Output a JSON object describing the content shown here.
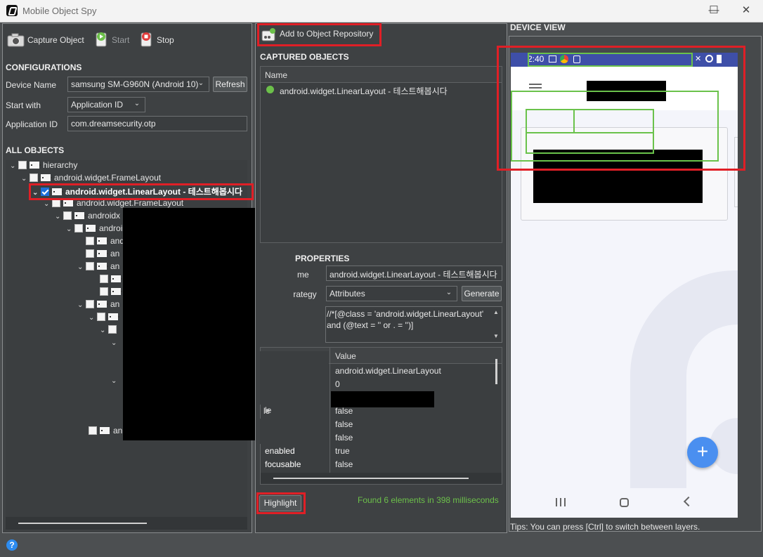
{
  "window": {
    "title": "Mobile Object Spy",
    "minimize": "—",
    "maximize": "☐",
    "close": "✕"
  },
  "toolbar": {
    "capture": "Capture Object",
    "start": "Start",
    "stop": "Stop"
  },
  "config": {
    "heading": "CONFIGURATIONS",
    "device_label": "Device Name",
    "device_value": "samsung SM-G960N (Android 10)",
    "refresh": "Refresh",
    "start_with_label": "Start with",
    "start_with_value": "Application ID",
    "app_id_label": "Application ID",
    "app_id_value": "com.dreamsecurity.otp"
  },
  "all_objects": {
    "heading": "ALL OBJECTS",
    "rows": [
      {
        "label": "hierarchy"
      },
      {
        "label": "android.widget.FrameLayout"
      },
      {
        "label": "android.widget.LinearLayout - 테스트해봅시다"
      },
      {
        "label": "android.widget.FrameLayout"
      },
      {
        "label": "androidx"
      },
      {
        "label": "androi"
      },
      {
        "label": "andr"
      },
      {
        "label": "an"
      },
      {
        "label": "an"
      },
      {
        "label": "an"
      },
      {
        "label": "an"
      }
    ]
  },
  "repo": {
    "add_button": "Add to Object Repository"
  },
  "captured": {
    "heading": "CAPTURED OBJECTS",
    "column": "Name",
    "items": [
      {
        "label": "android.widget.LinearLayout - 테스트해봅시다",
        "status_color": "#6cc04a"
      }
    ]
  },
  "props": {
    "heading": "OBJECT PROPERTIES",
    "heading_visible": "PROPERTIES",
    "name_label": "me",
    "name_value": "android.widget.LinearLayout - 테스트해봅시다",
    "strategy_label": "strategy",
    "strategy_value": "Attributes",
    "generate": "Generate",
    "xpath": "//*[@class = 'android.widget.LinearLayout' and (@text = '' or . = '')]",
    "value_col": "Value",
    "rows": [
      {
        "name": "",
        "value": "android.widget.LinearLayout"
      },
      {
        "name": "",
        "value": "0"
      },
      {
        "name": "",
        "value": ""
      },
      {
        "name": "le",
        "value": "false"
      },
      {
        "name": "",
        "value": "false"
      },
      {
        "name": "",
        "value": "false"
      },
      {
        "name": "enabled",
        "value": "true"
      },
      {
        "name": "focusable",
        "value": "false"
      }
    ]
  },
  "highlight": "Highlight",
  "found_msg": "Found 6 elements in 398 milliseconds",
  "device_view": {
    "heading": "DEVICE VIEW",
    "status_time": "2:40",
    "fab": "+",
    "tips": "Tips: You can press [Ctrl] to switch between layers."
  },
  "colors": {
    "accent_red": "#e01f26",
    "found_green": "#6cc04a",
    "overlay_green": "#6ac24b",
    "fab_blue": "#4a8ff0",
    "statusbar_blue": "#3e4fa8"
  }
}
